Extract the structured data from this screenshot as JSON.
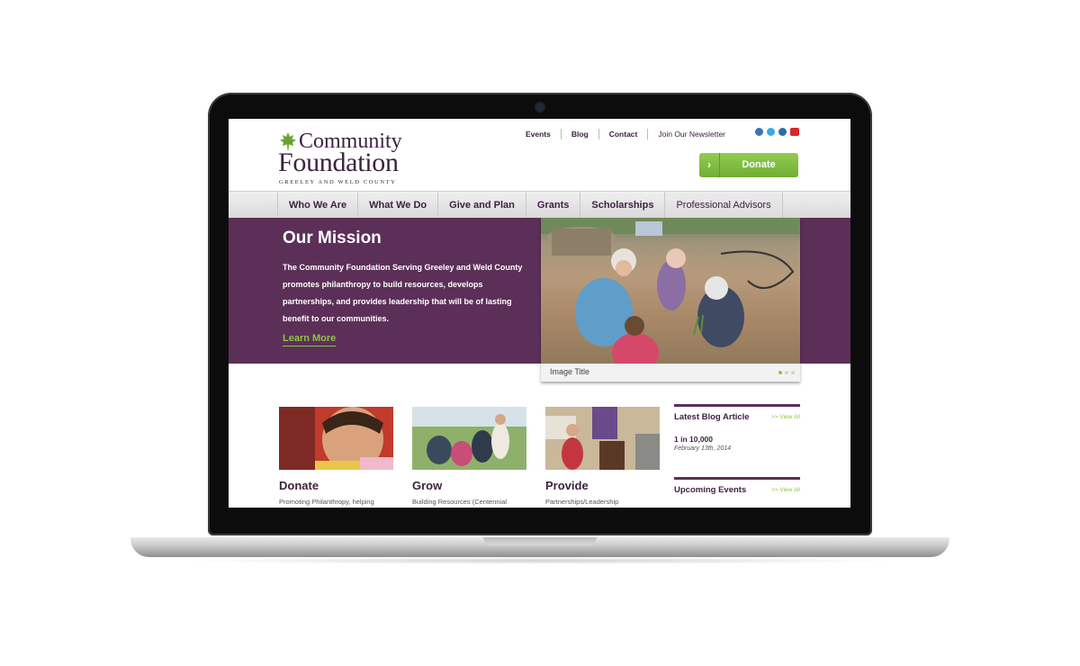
{
  "header": {
    "logo": {
      "line1": "Community",
      "line2": "Foundation",
      "line3": "GREELEY AND WELD COUNTY"
    },
    "top_links": [
      "Events",
      "Blog",
      "Contact",
      "Join Our Newsletter"
    ],
    "social_icons": [
      "facebook-icon",
      "twitter-icon",
      "linkedin-icon",
      "youtube-icon"
    ],
    "donate_label": "Donate"
  },
  "nav": {
    "items": [
      "Who We Are",
      "What We Do",
      "Give and Plan",
      "Grants",
      "Scholarships",
      "Professional Advisors"
    ]
  },
  "hero": {
    "title": "Our Mission",
    "text": "The Community Foundation Serving Greeley and Weld County promotes philanthropy to build resources, develops partnerships, and provides leadership that will be of lasting benefit to our communities.",
    "link": "Learn More",
    "image_caption": "Image Title"
  },
  "cards": [
    {
      "title": "Donate",
      "text": "Promoting Philanthropy, helping"
    },
    {
      "title": "Grow",
      "text": "Building Resources (Centennial"
    },
    {
      "title": "Provide",
      "text": "Partnerships/Leadership"
    }
  ],
  "sidebar": {
    "blog": {
      "title": "Latest Blog Article",
      "view_all": ">> View All",
      "article_title": "1 in 10,000",
      "article_date": "February 13th, 2014"
    },
    "events": {
      "title": "Upcoming Events",
      "view_all": ">> View All"
    }
  },
  "colors": {
    "brand_purple": "#5c2f58",
    "accent_green": "#8cc63f"
  }
}
